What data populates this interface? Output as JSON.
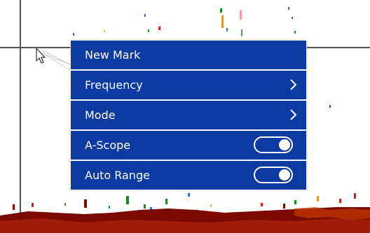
{
  "colors": {
    "menu_background": "#0b3aa0",
    "menu_text": "#ffffff",
    "echo_bottom": "#7a0a00",
    "echo_mid": "#c83a00",
    "cursor_line": "#555555"
  },
  "menu": {
    "items": [
      {
        "label": "New Mark",
        "control": "none"
      },
      {
        "label": "Frequency",
        "control": "submenu",
        "icon": "chevron-right-icon"
      },
      {
        "label": "Mode",
        "control": "submenu",
        "icon": "chevron-right-icon"
      },
      {
        "label": "A-Scope",
        "control": "toggle",
        "state": "on"
      },
      {
        "label": "Auto Range",
        "control": "toggle",
        "state": "on"
      }
    ]
  }
}
